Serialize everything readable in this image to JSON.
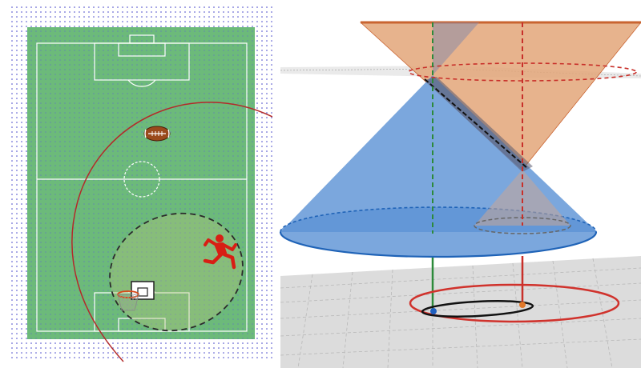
{
  "figure": {
    "left_panel": {
      "colors": {
        "field": "#6cba7a",
        "grid_dot": "#4343c8",
        "field_line": "#ffffff",
        "circle_red": "#b32a2a",
        "dashed_ellipse": "#2b2b2b",
        "runner": "#d81e14",
        "football": "#9a4a1c",
        "hoop_rim": "#d84a1a"
      },
      "icons": [
        "american-football-icon",
        "runner-icon",
        "basketball-hoop-icon"
      ]
    },
    "right_panel": {
      "colors": {
        "blue_cone": "#5e94d6",
        "blue_cone_edge": "#1f63b7",
        "orange_cone": "#e3a679",
        "orange_cone_edge": "#c96431",
        "red_circle": "#d0322c",
        "black_ellipse": "#111111",
        "green_axis": "#2d8a3a",
        "red_axis": "#c8302a",
        "ground_plane": "#dcdcdc",
        "ground_grid": "#b8b8b8",
        "blue_point": "#1f5fbf",
        "orange_point": "#e0782a"
      }
    }
  }
}
